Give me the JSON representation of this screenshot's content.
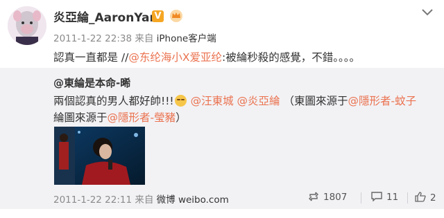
{
  "post": {
    "author": "炎亞綸_AaronYan",
    "verified_badge": "V",
    "timestamp": "2011-1-22 22:38",
    "source_prefix": "来自",
    "source": "iPhone客户端",
    "text_prefix": "認真一直都是 //",
    "text_mention": "@东纶海小X爱亚纶",
    "text_suffix": ":被綸秒殺的感覺，不錯。。。。"
  },
  "retweet": {
    "author": "@東綸是本命-晞",
    "line1_text": "兩個認真的男人都好帥!!!",
    "mention_1": "@汪東城",
    "mention_2": "@炎亞綸",
    "line1_paren": "（東圖來源于",
    "mention_3": "@隱形者-蚊子",
    "line2_text": "綸圖來源于",
    "mention_4": "@隱形者-瑩豬",
    "line2_end": "）",
    "timestamp": "2011-1-22 22:11",
    "source_prefix": "来自",
    "source": "微博 weibo.com",
    "repost_count": "1807",
    "comment_count": "11",
    "like_count": "2"
  },
  "icons": {
    "menu": "chevron-down-icon",
    "crown": "crown-icon",
    "repost": "repost-icon",
    "comment": "comment-icon",
    "like": "like-icon"
  },
  "colors": {
    "link": "#eb7350",
    "retweet_bg": "#f2f2f5",
    "verified": "#f5a623"
  }
}
